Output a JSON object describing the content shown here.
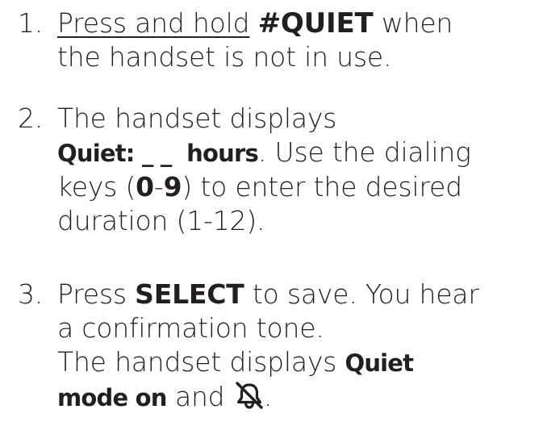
{
  "steps": [
    {
      "number": "1.",
      "line1_underlined": "Press and hold",
      "line1_key": "#QUIET",
      "line1_tail": "when",
      "line2": "the handset is not in use."
    },
    {
      "number": "2.",
      "line1": "The handset displays",
      "line2_display": "Quiet: _ _  hours",
      "line2_tail": ". Use the dialing",
      "line3_pre": "keys (",
      "line3_key_a": "0",
      "line3_dash": "-",
      "line3_key_b": "9",
      "line3_post": ") to enter the desired",
      "line4": "duration (1-12)."
    },
    {
      "number": "3.",
      "line1_pre": "Press",
      "line1_key": "SELECT",
      "line1_post": "to save. You hear",
      "line2": "a confirmation tone.",
      "line3_pre": "The handset displays",
      "line3_display": "Quiet",
      "line4_display": "mode on",
      "line4_mid": "and",
      "line4_icon": "bell-off-icon",
      "line4_end": "."
    }
  ]
}
